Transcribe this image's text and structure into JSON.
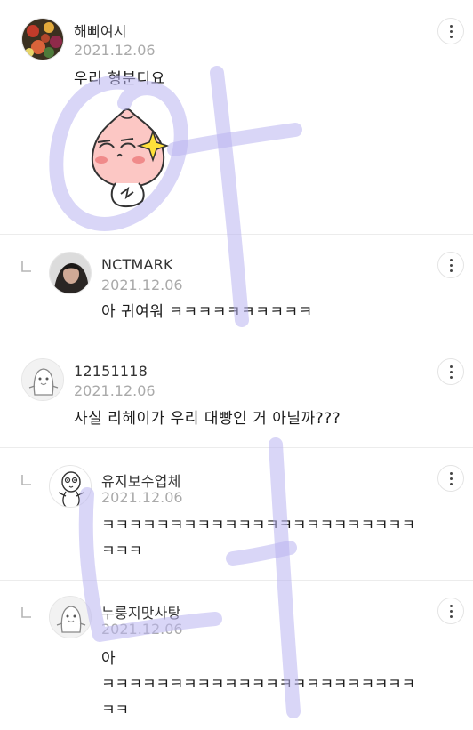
{
  "comments": [
    {
      "author": "해삐여시",
      "date": "2021.12.06",
      "text": "우리 형분디요",
      "avatar": "flowers-photo",
      "is_reply": false,
      "has_sticker": true,
      "sticker": "peach-character-sticker"
    },
    {
      "author": "NCTMARK",
      "date": "2021.12.06",
      "text": "아 귀여워 ㅋㅋㅋㅋㅋㅋㅋㅋㅋㅋ",
      "avatar": "person-photo",
      "is_reply": true
    },
    {
      "author": "12151118",
      "date": "2021.12.06",
      "text": "사실 리헤이가 우리 대빵인 거 아닐까???",
      "avatar": "default-character",
      "is_reply": false
    },
    {
      "author": "유지보수업체",
      "date": "2021.12.06",
      "text_lines": [
        "ㅋㅋㅋㅋㅋㅋㅋㅋㅋㅋㅋㅋㅋㅋㅋㅋㅋㅋㅋㅋㅋㅋㅋ",
        "ㅋㅋㅋ"
      ],
      "avatar": "doodle-character",
      "is_reply": true
    },
    {
      "author": "누룽지맛사탕",
      "date": "2021.12.06",
      "text_lines": [
        "아",
        "ㅋㅋㅋㅋㅋㅋㅋㅋㅋㅋㅋㅋㅋㅋㅋㅋㅋㅋㅋㅋㅋㅋㅋ",
        "ㅋㅋ"
      ],
      "avatar": "default-character",
      "is_reply": true
    }
  ],
  "icons": {
    "more": "more-vertical-icon",
    "reply": "reply-arrow-icon"
  },
  "colors": {
    "date": "#aaaaaa",
    "divider": "#ececec",
    "watermark": "#b9b4f0"
  }
}
